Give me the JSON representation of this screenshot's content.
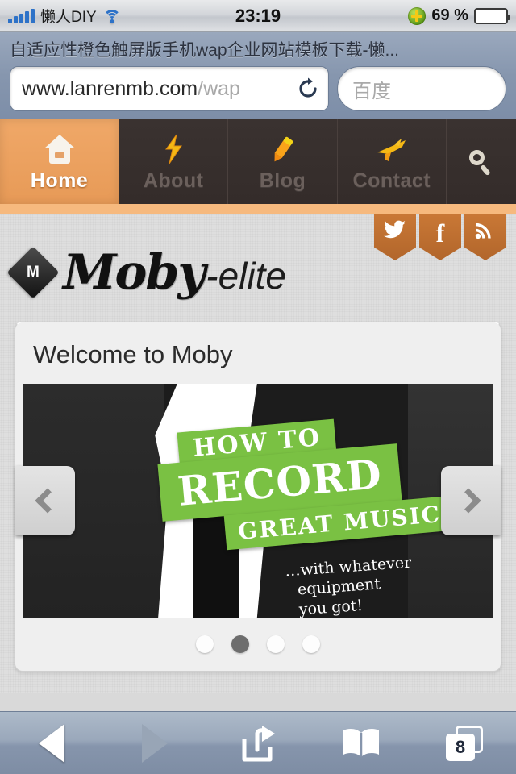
{
  "status_bar": {
    "carrier": "懒人DIY",
    "signal_icon": "signal-bars-icon",
    "wifi_icon": "wifi-icon",
    "time": "23:19",
    "badge_icon": "green-plus-badge-icon",
    "battery_percent": "69 %",
    "battery_level": 69
  },
  "browser": {
    "page_title": "自适应性橙色触屏版手机wap企业网站模板下载-懒...",
    "url_domain": "www.lanrenmb.com",
    "url_path": "/wap",
    "reload_icon": "reload-icon",
    "search_placeholder": "百度"
  },
  "site_nav": {
    "items": [
      {
        "label": "Home",
        "icon": "house-icon",
        "active": true
      },
      {
        "label": "About",
        "icon": "lightning-bolt-icon",
        "active": false
      },
      {
        "label": "Blog",
        "icon": "pen-icon",
        "active": false
      },
      {
        "label": "Contact",
        "icon": "airplane-icon",
        "active": false
      }
    ],
    "search_icon": "magnifier-icon"
  },
  "social": {
    "items": [
      {
        "name": "twitter",
        "glyph": "🐦"
      },
      {
        "name": "facebook",
        "glyph": "f"
      },
      {
        "name": "rss",
        "glyph": "(("
      }
    ]
  },
  "logo": {
    "badge_letter": "M",
    "name": "Moby",
    "suffix": "-elite"
  },
  "card": {
    "title": "Welcome to Moby",
    "slide": {
      "line1": "HOW TO",
      "line2": "RECORD",
      "line3": "GREAT MUSIC",
      "subtext_line1": "…with whatever",
      "subtext_line2": "equipment",
      "subtext_line3": "you got!",
      "banner_color": "#7ac143"
    },
    "prev_label": "‹",
    "next_label": "›",
    "dots_count": 4,
    "active_dot": 2
  },
  "toolbar": {
    "back_icon": "back-arrow-icon",
    "forward_icon": "forward-arrow-icon",
    "share_icon": "share-icon",
    "bookmarks_icon": "book-icon",
    "tabs_icon": "tabs-icon",
    "tabs_count": "8"
  },
  "colors": {
    "accent_orange": "#e79a57",
    "nav_dark": "#3a3230",
    "green": "#7ac143",
    "chrome_blue": "#8696ae"
  }
}
